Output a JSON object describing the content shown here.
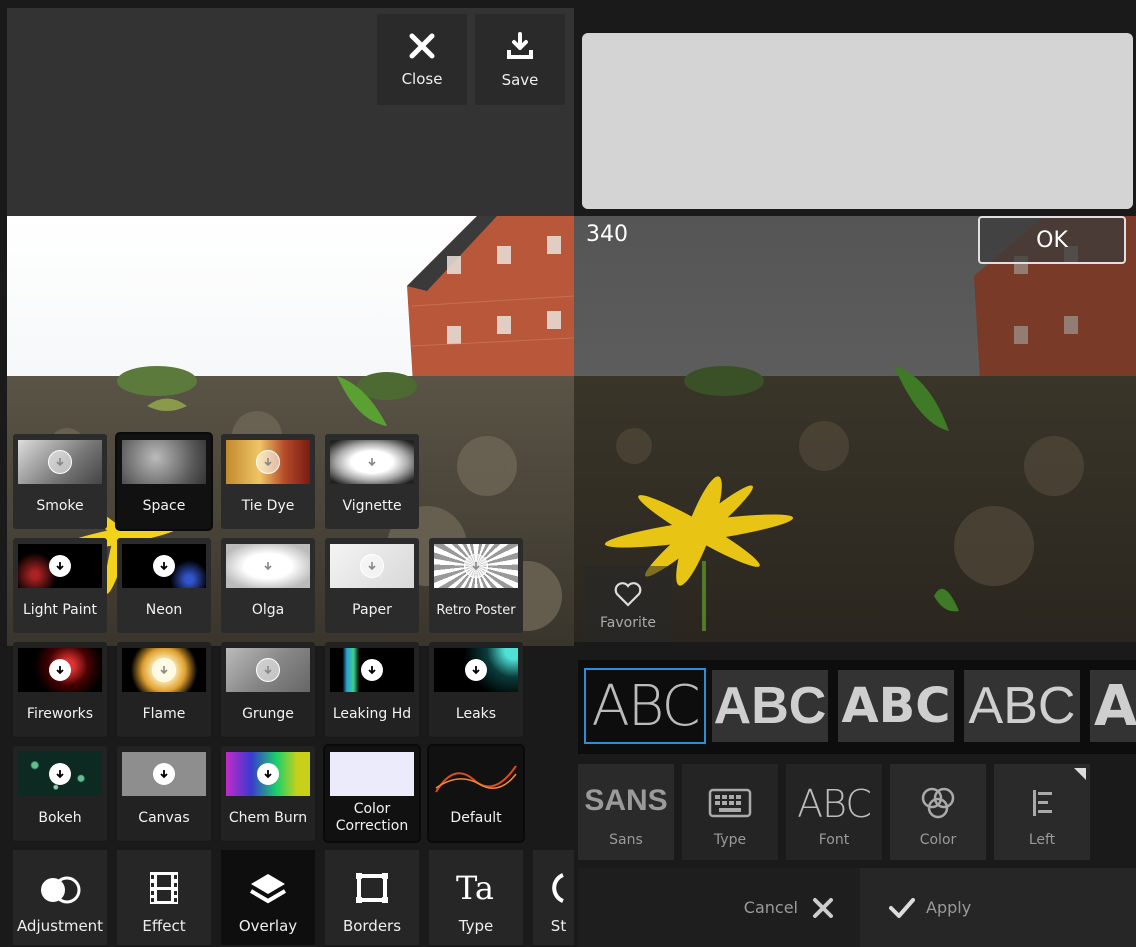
{
  "header": {
    "close_label": "Close",
    "save_label": "Save"
  },
  "overlays": [
    {
      "label": "Smoke",
      "icon": "light"
    },
    {
      "label": "Space",
      "icon": "light"
    },
    {
      "label": "Tie Dye",
      "icon": "light"
    },
    {
      "label": "Vignette",
      "icon": "light"
    },
    {
      "label": "Light Paint",
      "icon": "dark"
    },
    {
      "label": "Neon",
      "icon": "dark"
    },
    {
      "label": "Olga",
      "icon": "light"
    },
    {
      "label": "Paper",
      "icon": "light"
    },
    {
      "label": "Retro Poster",
      "icon": "light"
    },
    {
      "label": "Fireworks",
      "icon": "dark"
    },
    {
      "label": "Flame",
      "icon": "light"
    },
    {
      "label": "Grunge",
      "icon": "light"
    },
    {
      "label": "Leaking Hd",
      "icon": "dark"
    },
    {
      "label": "Leaks",
      "icon": "dark"
    },
    {
      "label": "Bokeh",
      "icon": "dark"
    },
    {
      "label": "Canvas",
      "icon": "dark"
    },
    {
      "label": "Chem Burn",
      "icon": "dark"
    },
    {
      "label": "Color Correction",
      "icon": "none"
    },
    {
      "label": "Default",
      "icon": "none"
    }
  ],
  "nav": {
    "adjustment": "Adjustment",
    "effect": "Effect",
    "overlay": "Overlay",
    "borders": "Borders",
    "type": "Type",
    "stickers_partial": "St"
  },
  "text_editor": {
    "char_count": "340",
    "ok_label": "OK",
    "favorite_label": "Favorite"
  },
  "text_styles": [
    "ABC",
    "ABC",
    "ABC",
    "ABC",
    "A"
  ],
  "text_tools": {
    "sans_preview": "SANS",
    "sans_label": "Sans",
    "type_label": "Type",
    "font_preview": "ABC",
    "font_label": "Font",
    "color_label": "Color",
    "align_label": "Left"
  },
  "actions": {
    "cancel_label": "Cancel",
    "apply_label": "Apply"
  },
  "colors": {
    "accent_blue": "#2b8fd6",
    "text_box": "#d4d4d4"
  }
}
